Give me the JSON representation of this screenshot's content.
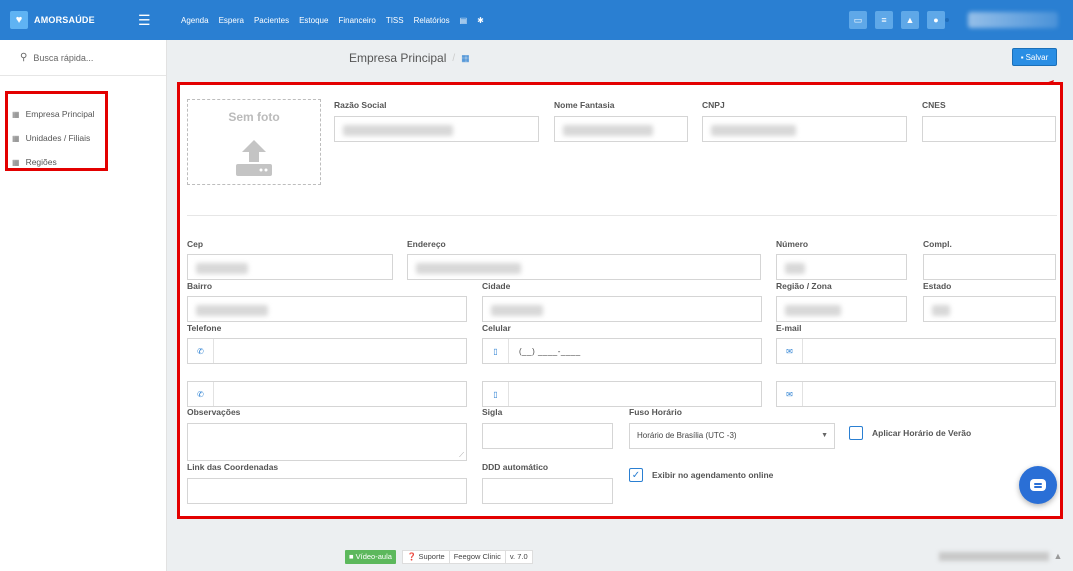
{
  "brand": {
    "name": "AMORSAÚDE"
  },
  "topnav": {
    "items": [
      "Agenda",
      "Espera",
      "Pacientes",
      "Estoque",
      "Financeiro",
      "TISS",
      "Relatórios"
    ]
  },
  "sidebar": {
    "search_label": "Busca rápida...",
    "items": [
      {
        "label": "Empresa Principal"
      },
      {
        "label": "Unidades / Filiais"
      },
      {
        "label": "Regiões"
      }
    ]
  },
  "header": {
    "title": "Empresa Principal",
    "save_label": "Salvar"
  },
  "form": {
    "photo_label": "Sem foto",
    "labels": {
      "razao_social": "Razão Social",
      "nome_fantasia": "Nome Fantasia",
      "cnpj": "CNPJ",
      "cnes": "CNES",
      "cep": "Cep",
      "endereco": "Endereço",
      "numero": "Número",
      "compl": "Compl.",
      "bairro": "Bairro",
      "cidade": "Cidade",
      "regiao_zona": "Região / Zona",
      "estado": "Estado",
      "telefone": "Telefone",
      "celular": "Celular",
      "email": "E-mail",
      "observacoes": "Observações",
      "sigla": "Sigla",
      "fuso_horario": "Fuso Horário",
      "link_coordenadas": "Link das Coordenadas",
      "ddd_automatico": "DDD automático"
    },
    "celular_mask": "(__) ____-____",
    "fuso_value": "Horário de Brasília (UTC -3)",
    "horario_verao_label": "Aplicar Horário de Verão",
    "horario_verao_checked": false,
    "agendamento_label": "Exibir no agendamento online",
    "agendamento_checked": true
  },
  "footer": {
    "video_label": "Vídeo-aula",
    "suporte_label": "Suporte",
    "product": "Feegow Clinic",
    "version": "v. 7.0"
  },
  "colors": {
    "primary": "#2a7fd2",
    "highlight": "#e30000",
    "success": "#5cb85c"
  }
}
